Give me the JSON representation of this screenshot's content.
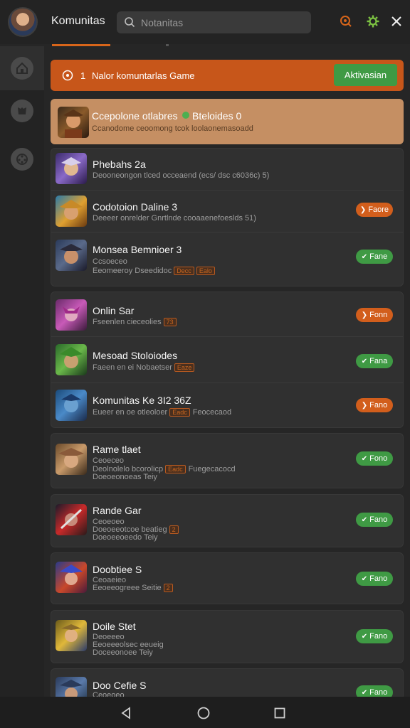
{
  "header": {
    "title": "Komunitas",
    "search_placeholder": "Notanitas",
    "icons": [
      "search-icon",
      "notification-icon",
      "settings-icon",
      "close-icon"
    ],
    "accent": "#d7651a"
  },
  "rail": {
    "items": [
      "home-icon",
      "community-icon",
      "games-icon"
    ]
  },
  "banner": {
    "num": "1",
    "text": "Nalor komuntarlas Game",
    "button": "Aktivasian"
  },
  "featured": {
    "title": "Ccepolone otlabres",
    "title2": "Bteloides 0",
    "subtitle": "Ccanodome ceoomong tcok loolaonemasoadd"
  },
  "groups": [
    {
      "rows": [
        {
          "title": "Phebahs 2a",
          "sub": "Deooneongon tlced occeaend (ecs/ dsc c6036c) 5)",
          "tag": "",
          "tag2": "",
          "sub2": "",
          "pill": null
        },
        {
          "title": "Codotoion Daline 3",
          "sub": "Deeeer onrelder Gnrtlnde cooaaenefoeslds 51)",
          "tag": "",
          "tag2": "",
          "sub2": "",
          "pill": {
            "label": "Faore",
            "color": "orange"
          }
        },
        {
          "title": "Monsea Bemnioer 3",
          "sub": "Ccsoeceo",
          "sub2": "Eeomeeroy Dseedidoc",
          "tag": "Decc",
          "tag2": "Ealo",
          "pill": {
            "label": "Fane",
            "color": "green"
          }
        }
      ]
    },
    {
      "rows": [
        {
          "title": "Onlin Sar",
          "sub": "Fseenlen cieceolies",
          "tag": "73",
          "tag2": "",
          "sub2": "",
          "pill": {
            "label": "Fonn",
            "color": "orange"
          }
        },
        {
          "title": "Mesoad Stoloiodes",
          "sub": "Faeen en ei Nobaetser",
          "tag": "Eaze",
          "tag2": "",
          "sub2": "",
          "pill": {
            "label": "Fana",
            "color": "green"
          }
        },
        {
          "title": "Komunitas Ke 3I2 36Z",
          "sub": "Eueer en oe otleoloer",
          "tag": "Eadc",
          "tag2": "Feocecaod",
          "sub2": "",
          "pill": {
            "label": "Fano",
            "color": "orange"
          }
        }
      ]
    },
    {
      "rows": [
        {
          "title": "Rame tlaet",
          "sub": "Ceoeceo",
          "sub2": "Deolnolelo bcorolicp",
          "sub3": "Doeoeonoeas Teiy",
          "tag": "Eadc",
          "tag2": "Fuegecacocd",
          "pill": {
            "label": "Fono",
            "color": "green"
          }
        }
      ]
    },
    {
      "rows": [
        {
          "title": "Rande Gar",
          "sub": "Ceoeoeo",
          "sub2": "Doeoeeotcoe beatieg",
          "sub3": "Doeoeeoeedo Teiy",
          "tag": "2",
          "tag2": "",
          "pill": {
            "label": "Fano",
            "color": "green"
          }
        }
      ]
    },
    {
      "rows": [
        {
          "title": "Doobtiee S",
          "sub": "Ceoaeieo",
          "sub2": "Eeoeeogreee Seitie",
          "sub3": "",
          "tag": "2",
          "tag2": "",
          "pill": {
            "label": "Fano",
            "color": "green"
          }
        }
      ]
    },
    {
      "rows": [
        {
          "title": "Doile Stet",
          "sub": "Deoeeeo",
          "sub2": "Eeoeeeolsec eeueig",
          "sub3": "Doceeonoee Teiy",
          "tag": "",
          "tag2": "",
          "pill": {
            "label": "Fano",
            "color": "green"
          }
        }
      ]
    },
    {
      "rows": [
        {
          "title": "Doo Cefie S",
          "sub": "Ceoeoeo",
          "sub2": "",
          "sub3": "",
          "tag": "",
          "tag2": "",
          "pill": {
            "label": "Fano",
            "color": "green"
          }
        }
      ]
    }
  ],
  "navbar": {
    "icons": [
      "back-icon",
      "home-circle-icon",
      "recents-icon"
    ]
  }
}
